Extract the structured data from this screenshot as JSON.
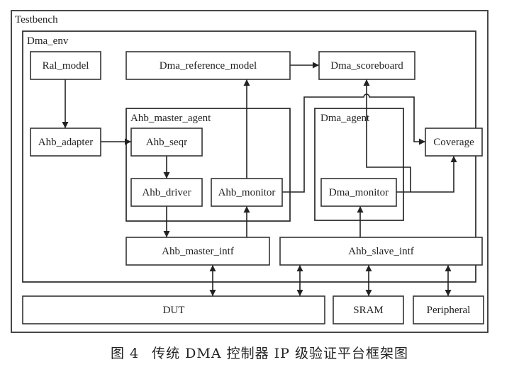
{
  "diagram": {
    "containers": {
      "testbench": "Testbench",
      "dma_env": "Dma_env",
      "ahb_master_agent": "Ahb_master_agent",
      "dma_agent": "Dma_agent"
    },
    "blocks": {
      "ral_model": "Ral_model",
      "dma_reference_model": "Dma_reference_model",
      "dma_scoreboard": "Dma_scoreboard",
      "ahb_adapter": "Ahb_adapter",
      "ahb_seqr": "Ahb_seqr",
      "ahb_driver": "Ahb_driver",
      "ahb_monitor": "Ahb_monitor",
      "dma_monitor": "Dma_monitor",
      "coverage": "Coverage",
      "ahb_master_intf": "Ahb_master_intf",
      "ahb_slave_intf": "Ahb_slave_intf",
      "dut": "DUT",
      "sram": "SRAM",
      "peripheral": "Peripheral"
    },
    "connections": [
      {
        "from": "Ral_model",
        "to": "Ahb_adapter",
        "type": "arrow"
      },
      {
        "from": "Ahb_adapter",
        "to": "Ahb_seqr",
        "type": "arrow"
      },
      {
        "from": "Ahb_seqr",
        "to": "Ahb_driver",
        "type": "arrow"
      },
      {
        "from": "Ahb_driver",
        "to": "Ahb_master_intf",
        "type": "arrow"
      },
      {
        "from": "Ahb_master_intf",
        "to": "Ahb_monitor",
        "type": "arrow"
      },
      {
        "from": "Ahb_monitor",
        "to": "Dma_reference_model",
        "type": "arrow"
      },
      {
        "from": "Ahb_monitor",
        "to": "Coverage",
        "type": "arrow"
      },
      {
        "from": "Dma_reference_model",
        "to": "Dma_scoreboard",
        "type": "arrow"
      },
      {
        "from": "Dma_monitor",
        "to": "Dma_scoreboard",
        "type": "arrow"
      },
      {
        "from": "Dma_monitor",
        "to": "Coverage",
        "type": "arrow"
      },
      {
        "from": "Ahb_slave_intf",
        "to": "Dma_monitor",
        "type": "arrow"
      },
      {
        "from": "Ahb_master_intf",
        "to": "DUT",
        "type": "bidirectional"
      },
      {
        "from": "Ahb_slave_intf",
        "to": "DUT",
        "type": "bidirectional"
      },
      {
        "from": "Ahb_slave_intf",
        "to": "SRAM",
        "type": "bidirectional"
      },
      {
        "from": "Ahb_slave_intf",
        "to": "Peripheral",
        "type": "bidirectional"
      }
    ]
  },
  "caption": {
    "figure_number": "图 4",
    "text": "传统 DMA 控制器 IP 级验证平台框架图"
  }
}
